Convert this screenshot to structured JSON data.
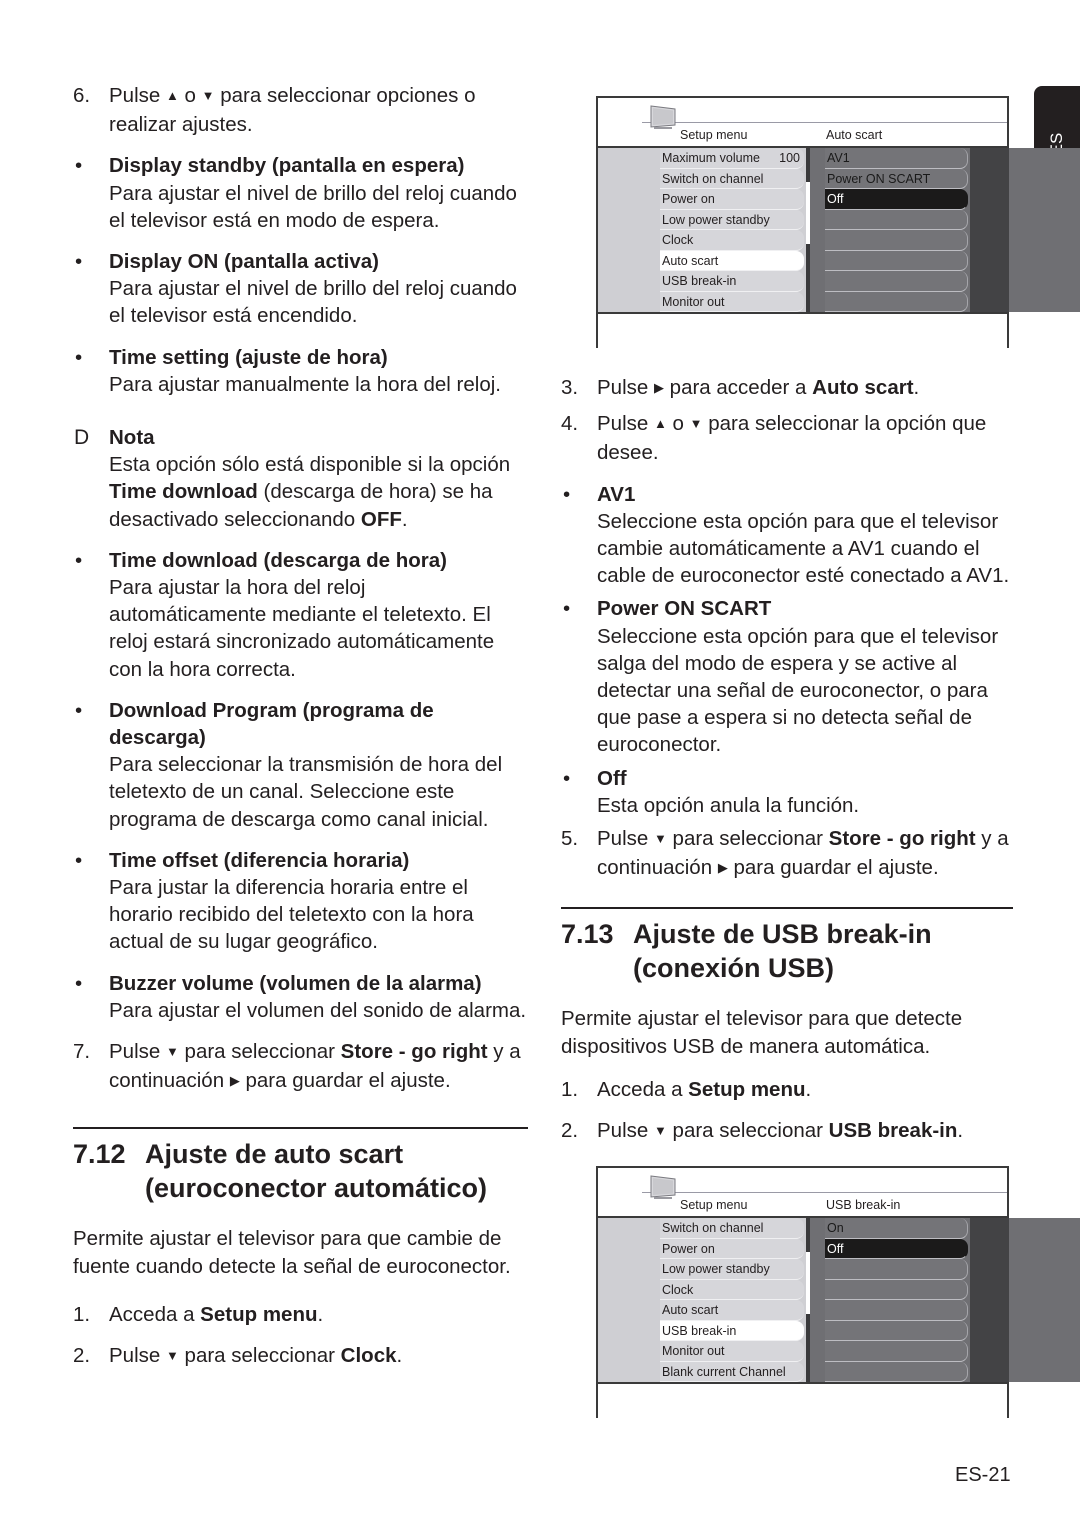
{
  "lang_tab": "ES",
  "page_number": "ES-21",
  "left_column": {
    "step6": {
      "num": "6.",
      "text_a": "Pulse ",
      "up": "▲",
      "text_b": " o ",
      "down": "▼",
      "text_c": " para seleccionar opciones o realizar ajustes."
    },
    "bullets": [
      {
        "title": "Display standby (pantalla en espera)",
        "desc": "Para ajustar el nivel de brillo del reloj cuando el televisor está en modo de espera."
      },
      {
        "title": "Display ON (pantalla activa)",
        "desc": "Para ajustar el nivel de brillo del reloj cuando el televisor está encendido."
      },
      {
        "title": "Time setting (ajuste de hora)",
        "desc": "Para ajustar manualmente la hora del reloj."
      }
    ],
    "note": {
      "marker": "D",
      "title": "Nota",
      "text_a": "Esta opción sólo está disponible si la opción ",
      "bold_a": "Time download",
      "text_b": " (descarga de hora) se ha desactivado seleccionando ",
      "bold_b": "OFF",
      "text_c": "."
    },
    "bullets2": [
      {
        "title": "Time download (descarga de hora)",
        "desc": "Para ajustar la hora del reloj automáticamente mediante el teletexto. El reloj estará sincronizado automáticamente con la hora correcta."
      },
      {
        "title": "Download Program (programa de descarga)",
        "desc": "Para seleccionar la transmisión de hora del teletexto de un canal. Seleccione este programa de descarga como canal inicial."
      },
      {
        "title": "Time offset (diferencia horaria)",
        "desc": "Para justar la diferencia horaria entre el horario recibido del teletexto con la hora actual de su lugar geográfico."
      },
      {
        "title": "Buzzer volume (volumen de la alarma)",
        "desc": "Para ajustar el volumen del sonido de alarma."
      }
    ],
    "step7": {
      "num": "7.",
      "text_a": "Pulse ",
      "down": "▼",
      "text_b": " para seleccionar ",
      "bold": "Store - go right",
      "text_c": " y a continuación ",
      "right": "▶",
      "text_d": " para guardar el ajuste."
    },
    "section": {
      "number": "7.12",
      "title": "Ajuste de auto scart (euroconector automático)",
      "intro": "Permite ajustar el televisor para que cambie de fuente cuando detecte la señal de euroconector.",
      "step1": {
        "num": "1.",
        "text": "Acceda a ",
        "bold": "Setup menu",
        "end": "."
      },
      "step2": {
        "num": "2.",
        "text_a": "Pulse ",
        "down": "▼",
        "text_b": " para seleccionar ",
        "bold": "Clock",
        "end": "."
      }
    }
  },
  "osd_auto_scart": {
    "left_title": "Setup menu",
    "right_title": "Auto scart",
    "left_items": [
      {
        "label": "Maximum volume",
        "value": "100"
      },
      {
        "label": "Switch on channel",
        "value": ""
      },
      {
        "label": "Power on",
        "value": ""
      },
      {
        "label": "Low power standby",
        "value": ""
      },
      {
        "label": "Clock",
        "value": ""
      },
      {
        "label": "Auto scart",
        "value": "",
        "selected": true
      },
      {
        "label": "USB break-in",
        "value": ""
      },
      {
        "label": "Monitor out",
        "value": ""
      }
    ],
    "right_items": [
      {
        "label": "AV1"
      },
      {
        "label": "Power ON SCART"
      },
      {
        "label": "Off",
        "selected": true
      },
      {
        "label": ""
      },
      {
        "label": ""
      },
      {
        "label": ""
      },
      {
        "label": ""
      },
      {
        "label": ""
      }
    ]
  },
  "right_column": {
    "step3": {
      "num": "3.",
      "text_a": "Pulse ",
      "right": "▶",
      "text_b": " para acceder a ",
      "bold": "Auto scart",
      "end": "."
    },
    "step4": {
      "num": "4.",
      "text_a": "Pulse ",
      "up": "▲",
      "text_b": " o ",
      "down": "▼",
      "text_c": " para seleccionar la opción que desee."
    },
    "bullets": [
      {
        "title": "AV1",
        "desc": "Seleccione esta opción para que el televisor cambie automáticamente a AV1 cuando el cable de euroconector esté conectado a AV1."
      },
      {
        "title": "Power ON SCART",
        "desc": "Seleccione esta opción para que el televisor salga del modo de espera y se active al detectar una señal de euroconector, o para que pase a espera si no detecta señal de euroconector."
      },
      {
        "title": "Off",
        "desc": "Esta opción anula la función."
      }
    ],
    "step5": {
      "num": "5.",
      "text_a": "Pulse ",
      "down": "▼",
      "text_b": " para seleccionar ",
      "bold": "Store - go right",
      "text_c": " y a continuación ",
      "right": "▶",
      "text_d": " para guardar el ajuste."
    },
    "section": {
      "number": "7.13",
      "title": "Ajuste de USB break-in (conexión USB)",
      "intro": "Permite ajustar el televisor para que detecte dispositivos USB de manera automática.",
      "step1": {
        "num": "1.",
        "text": "Acceda a ",
        "bold": "Setup menu",
        "end": "."
      },
      "step2": {
        "num": "2.",
        "text_a": "Pulse ",
        "down": "▼",
        "text_b": " para seleccionar ",
        "bold": "USB break-in",
        "end": "."
      }
    }
  },
  "osd_usb": {
    "left_title": "Setup menu",
    "right_title": "USB break-in",
    "left_items": [
      {
        "label": "Switch on channel",
        "value": ""
      },
      {
        "label": "Power on",
        "value": ""
      },
      {
        "label": "Low power standby",
        "value": ""
      },
      {
        "label": "Clock",
        "value": ""
      },
      {
        "label": "Auto scart",
        "value": ""
      },
      {
        "label": "USB break-in",
        "value": "",
        "selected": true
      },
      {
        "label": "Monitor out",
        "value": ""
      },
      {
        "label": "Blank current Channel",
        "value": ""
      }
    ],
    "right_items": [
      {
        "label": "On"
      },
      {
        "label": "Off",
        "selected": true
      },
      {
        "label": ""
      },
      {
        "label": ""
      },
      {
        "label": ""
      },
      {
        "label": ""
      },
      {
        "label": ""
      },
      {
        "label": ""
      }
    ]
  }
}
